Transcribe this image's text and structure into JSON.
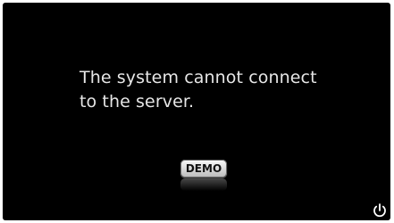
{
  "message": {
    "line1": "The system cannot connect",
    "line2": "to the server."
  },
  "demo_button": {
    "label": "DEMO"
  },
  "icons": {
    "power": "power-icon"
  },
  "colors": {
    "background": "#000000",
    "text": "#e6e6e6"
  }
}
